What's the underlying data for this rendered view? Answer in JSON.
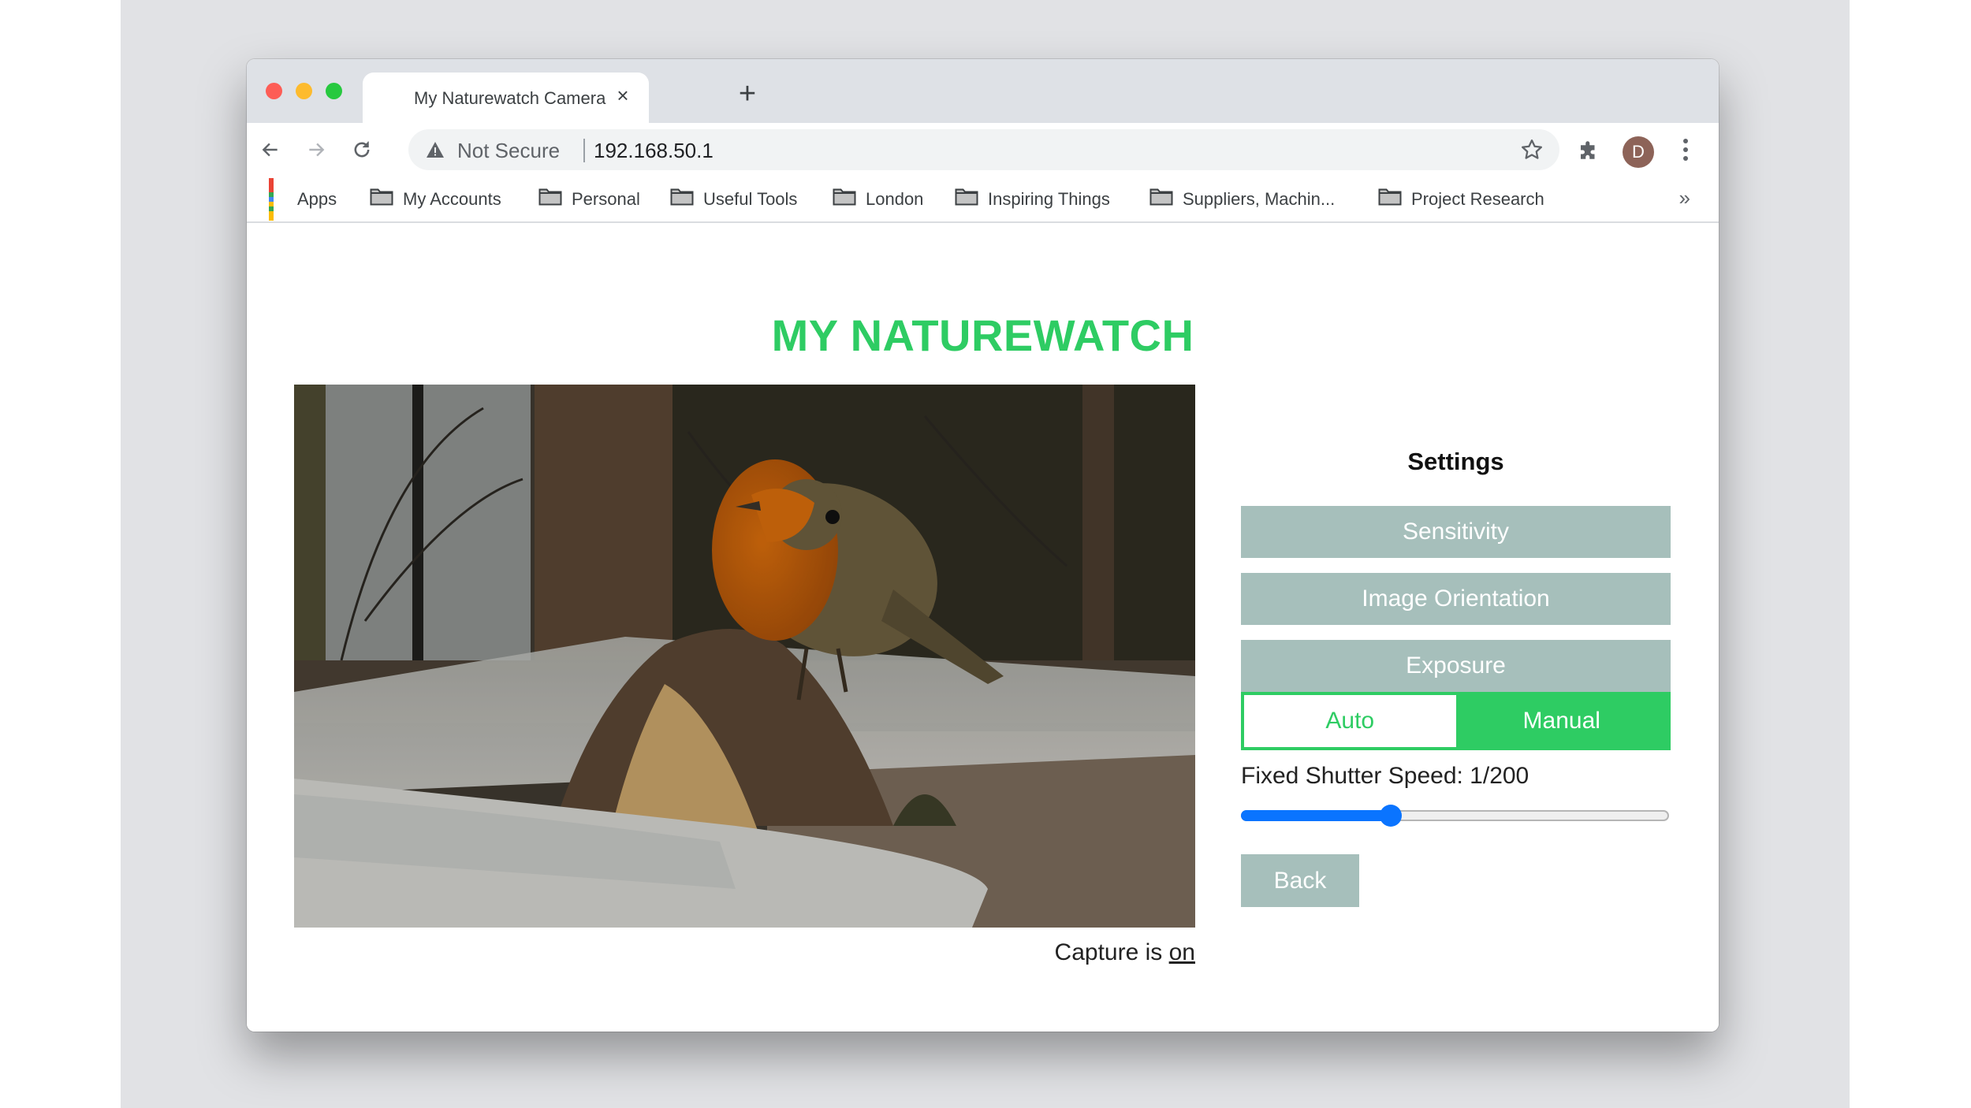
{
  "browser": {
    "tab": {
      "title": "My Naturewatch Camera"
    },
    "address": {
      "security_label": "Not Secure",
      "url": "192.168.50.1"
    },
    "profile_initial": "D",
    "bookmarks": [
      {
        "label": "Apps",
        "icon": "apps-grid-icon"
      },
      {
        "label": "My Accounts",
        "icon": "folder-icon"
      },
      {
        "label": "Personal",
        "icon": "folder-icon"
      },
      {
        "label": "Useful Tools",
        "icon": "folder-icon"
      },
      {
        "label": "London",
        "icon": "folder-icon"
      },
      {
        "label": "Inspiring Things",
        "icon": "folder-icon"
      },
      {
        "label": "Suppliers, Machin...",
        "icon": "folder-icon"
      },
      {
        "label": "Project Research",
        "icon": "folder-icon"
      }
    ],
    "bookmarks_overflow": "»"
  },
  "page": {
    "title": "MY NATUREWATCH",
    "photo_alt": "Live camera view: a robin perched on a log above a tray of bird seed",
    "capture": {
      "prefix": "Capture is ",
      "state": "on"
    },
    "settings": {
      "title": "Settings",
      "buttons": {
        "sensitivity": "Sensitivity",
        "image_orientation": "Image Orientation",
        "exposure": "Exposure"
      },
      "exposure_mode": {
        "options": [
          "Auto",
          "Manual"
        ],
        "selected": "Manual"
      },
      "shutter": {
        "label": "Fixed Shutter Speed: 1/200",
        "slider_fraction": 0.35
      },
      "back_label": "Back"
    },
    "colors": {
      "accent_green": "#2ecc63",
      "settings_button": "#a6bfbb",
      "slider_blue": "#0a74ff"
    }
  }
}
